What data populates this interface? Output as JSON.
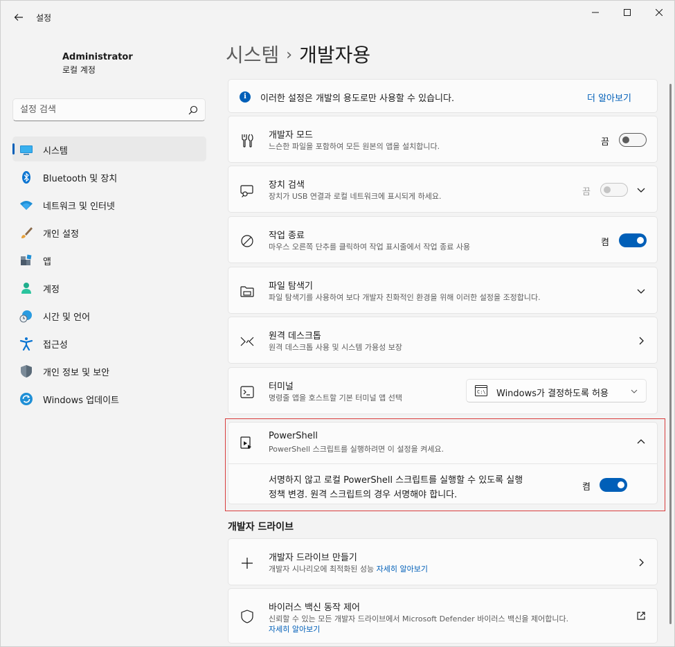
{
  "window": {
    "app_title": "설정",
    "controls": {
      "minimize": "minimize-icon",
      "maximize": "maximize-icon",
      "close": "close-icon"
    }
  },
  "profile": {
    "name": "Administrator",
    "account_type": "로컬 계정"
  },
  "search": {
    "placeholder": "설정 검색"
  },
  "sidebar": {
    "items": [
      {
        "label": "시스템",
        "icon": "system-icon",
        "active": true
      },
      {
        "label": "Bluetooth 및 장치",
        "icon": "bluetooth-icon"
      },
      {
        "label": "네트워크 및 인터넷",
        "icon": "wifi-icon"
      },
      {
        "label": "개인 설정",
        "icon": "brush-icon"
      },
      {
        "label": "앱",
        "icon": "apps-icon"
      },
      {
        "label": "계정",
        "icon": "account-icon"
      },
      {
        "label": "시간 및 언어",
        "icon": "globe-clock-icon"
      },
      {
        "label": "접근성",
        "icon": "accessibility-icon"
      },
      {
        "label": "개인 정보 및 보안",
        "icon": "shield-icon"
      },
      {
        "label": "Windows 업데이트",
        "icon": "update-icon"
      }
    ]
  },
  "breadcrumb": {
    "parent": "시스템",
    "separator": "›",
    "current": "개발자용"
  },
  "info_bar": {
    "text": "이러한 설정은 개발의 용도로만 사용할 수 있습니다.",
    "link": "더 알아보기"
  },
  "settings": {
    "dev_mode": {
      "title": "개발자 모드",
      "subtitle": "느슨한 파일을 포함하여 모든 원본의 앱을 설치합니다.",
      "state": "끔"
    },
    "device_discovery": {
      "title": "장치 검색",
      "subtitle": "장치가 USB 연결과 로컬 네트워크에 표시되게 하세요.",
      "state": "끔"
    },
    "end_task": {
      "title": "작업 종료",
      "subtitle": "마우스 오른쪽 단추를 클릭하여 작업 표시줄에서 작업 종료 사용",
      "state": "켬"
    },
    "file_explorer": {
      "title": "파일 탐색기",
      "subtitle": "파일 탐색기를 사용하여 보다 개발자 친화적인 환경을 위해 이러한 설정을 조정합니다."
    },
    "remote_desktop": {
      "title": "원격 데스크톱",
      "subtitle": "원격 데스크톱 사용 및 시스템 가용성 보장"
    },
    "terminal": {
      "title": "터미널",
      "subtitle": "명령줄 앱을 호스트할 기본 터미널 앱 선택",
      "select_value": "Windows가 결정하도록 허용"
    },
    "powershell": {
      "title": "PowerShell",
      "subtitle": "PowerShell 스크립트를 실행하려면 이 설정을 켜세요.",
      "detail_line1": "서명하지 않고 로컬 PowerShell 스크립트를 실행할 수 있도록 실행",
      "detail_line2": "정책 변경. 원격 스크립트의 경우 서명해야 합니다.",
      "state": "켬"
    }
  },
  "dev_drive": {
    "heading": "개발자 드라이브",
    "create": {
      "title": "개발자 드라이브 만들기",
      "subtitle": "개발자 시나리오에 최적화된 성능",
      "link": "자세히 알아보기"
    },
    "antivirus": {
      "title": "바이러스 백신 동작 제어",
      "subtitle": "신뢰할 수 있는 모든 개발자 드라이브에서 Microsoft Defender 바이러스 백신을 제어합니다.",
      "link": "자세히 알아보기"
    }
  },
  "colors": {
    "accent": "#005fb8",
    "highlight_border": "#d83b3b",
    "background": "#f3f3f3",
    "card": "#fbfbfb"
  }
}
